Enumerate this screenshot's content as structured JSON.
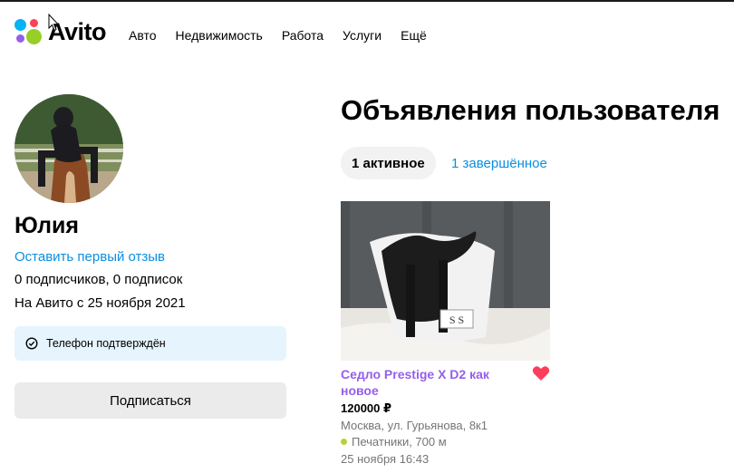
{
  "header": {
    "logo_text": "Avito",
    "nav": [
      "Авто",
      "Недвижимость",
      "Работа",
      "Услуги",
      "Ещё"
    ]
  },
  "profile": {
    "name": "Юлия",
    "review_link": "Оставить первый отзыв",
    "subscriptions": "0 подписчиков, 0 подписок",
    "since": "На Авито с 25 ноября 2021",
    "verified": "Телефон подтверждён",
    "subscribe_button": "Подписаться"
  },
  "listings": {
    "title": "Объявления пользователя",
    "tab_active": "1 активное",
    "tab_completed": "1 завершённое",
    "items": [
      {
        "title": "Седло Prestige X D2 как новое",
        "price": "120000 ₽",
        "address": "Москва, ул. Гурьянова, 8к1",
        "metro": "Печатники, 700 м",
        "date": "25 ноября 16:43",
        "saddle_pad_text": "S S"
      }
    ]
  },
  "colors": {
    "link": "#0a8fe0",
    "listing_title": "#965eeb",
    "heart": "#ff3d5a",
    "metro_line": "#b5d334",
    "verified_bg": "#e5f4fd"
  }
}
